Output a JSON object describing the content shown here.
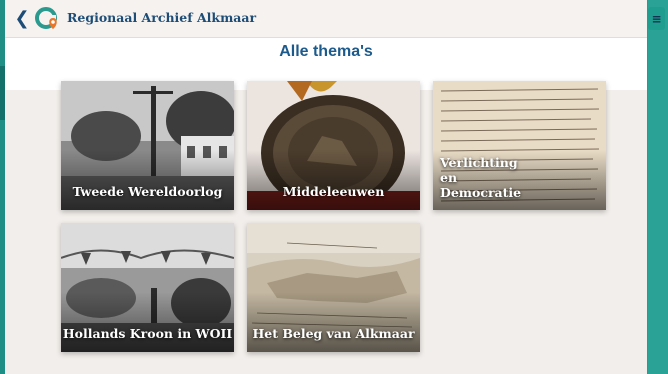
{
  "header": {
    "back_icon": "chevron-left-icon",
    "logo_icon": "app-logo-icon",
    "title": "Regionaal Archief Alkmaar",
    "menu_icon": "hamburger-menu-icon"
  },
  "page": {
    "title": "Alle thema's"
  },
  "themes": [
    {
      "label": "Tweede Wereldoorlog"
    },
    {
      "label": "Middeleeuwen"
    },
    {
      "label": "Verlichting en Democratie"
    },
    {
      "label": "Hollands Kroon in WOII"
    },
    {
      "label": "Het Beleg van Alkmaar"
    }
  ],
  "colors": {
    "teal": "#2a9a8f",
    "navy": "#1d4d77",
    "background": "#f2eeeb",
    "logo_orange": "#e8762b"
  }
}
